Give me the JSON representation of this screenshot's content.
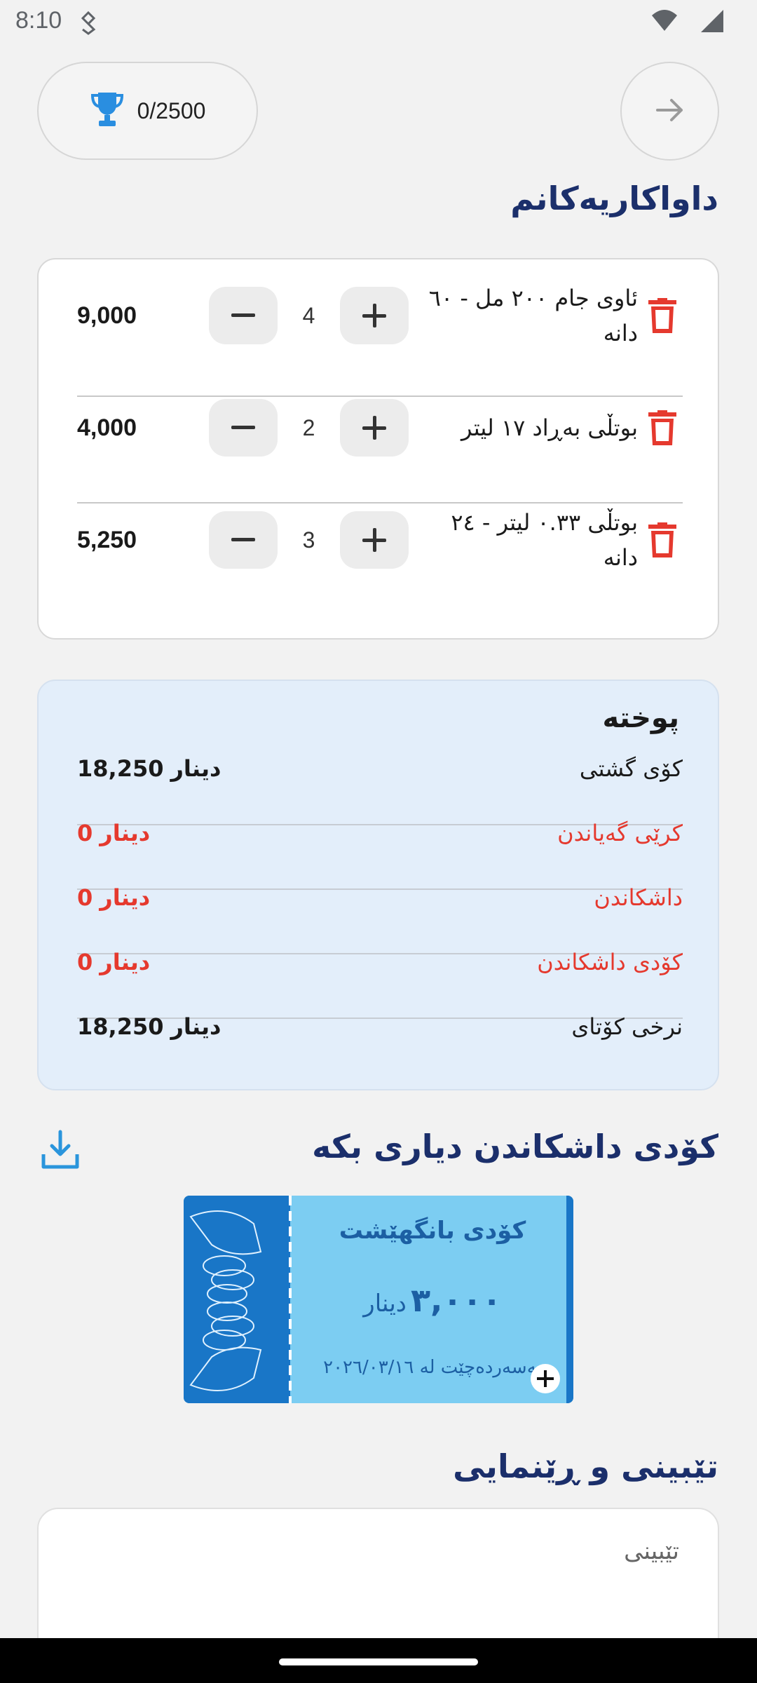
{
  "status_bar": {
    "time": "8:10"
  },
  "header": {
    "trophy_progress": "0/2500"
  },
  "cart": {
    "title": "داواکاریەکانم",
    "items": [
      {
        "name": "ئاوی جام ٢٠٠ مل - ٦٠ دانە",
        "quantity": "4",
        "price": "9,000"
      },
      {
        "name": "بوتڵی بەڕاد ١٧ لیتر",
        "quantity": "2",
        "price": "4,000"
      },
      {
        "name": "بوتڵی ٠.٣٣ لیتر - ٢٤ دانە",
        "quantity": "3",
        "price": "5,250"
      }
    ]
  },
  "summary": {
    "title": "پوختە",
    "rows": [
      {
        "label": "کۆی گشتی",
        "amount": "18,250",
        "currency": "دینار"
      },
      {
        "label": "کرێی گەیاندن",
        "amount": "0",
        "currency": "دینار"
      },
      {
        "label": "داشکاندن",
        "amount": "0",
        "currency": "دینار"
      },
      {
        "label": "کۆدی داشکاندن",
        "amount": "0",
        "currency": "دینار"
      },
      {
        "label": "نرخی کۆتای",
        "amount": "18,250",
        "currency": "دینار"
      }
    ]
  },
  "discount": {
    "title": "کۆدی داشکاندن دیاری بکە",
    "coupon": {
      "title": "کۆدی بانگهێشت",
      "amount": "٣,٠٠٠",
      "currency": "دینار",
      "expiry": "بەسەردەچێت لە ٢٠٢٦/٠٣/١٦"
    }
  },
  "notes": {
    "title": "تێبینی و ڕێنمایی",
    "placeholder": "تێبینی"
  },
  "colors": {
    "primary_dark": "#1b2f6b",
    "danger": "#e5392e",
    "summary_bg": "#e3eefa",
    "coupon_bg": "#7ccdf2",
    "coupon_dark": "#1976c7"
  }
}
